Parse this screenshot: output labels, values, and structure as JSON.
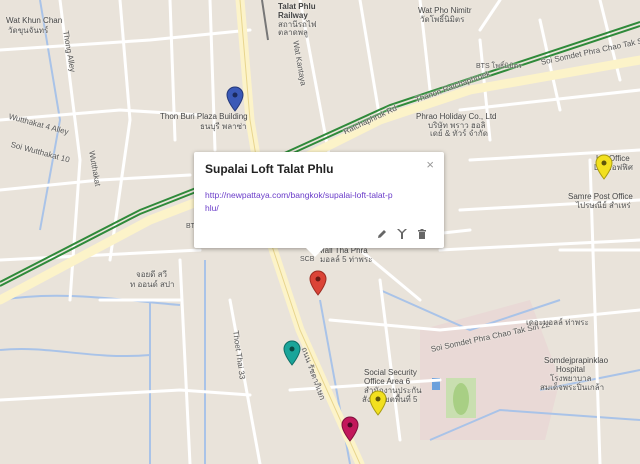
{
  "map": {
    "labels": [
      {
        "text": "Wat Khun Chan"
      },
      {
        "text": "วัดขุนจันทร์"
      },
      {
        "text": "Thong Alley"
      },
      {
        "text": "Talat Phlu"
      },
      {
        "text": "Railway"
      },
      {
        "text": "สถานีรถไฟ"
      },
      {
        "text": "ตลาดพลู"
      },
      {
        "text": "Wat Pho Nimitr"
      },
      {
        "text": "วัดโพธิ์นิมิตร"
      },
      {
        "text": "BTS โพธิ์นิมิตร"
      },
      {
        "text": "Wat Kantaya"
      },
      {
        "text": "Thon Buri Plaza Building"
      },
      {
        "text": "ธนบุรี พลาซ่า"
      },
      {
        "text": "Wutthakat 4 Alley"
      },
      {
        "text": "Soi Wutthakat 10"
      },
      {
        "text": "Wutthakat"
      },
      {
        "text": "Ratchaphruk Rd"
      },
      {
        "text": "Thanon Ratchaphruek"
      },
      {
        "text": "Soi Somdet Phra Chao Tak Sin"
      },
      {
        "text": "Phrao Holiday Co., Ltd"
      },
      {
        "text": "บริษัท พราว ฮอลิ"
      },
      {
        "text": "เดย์ & ทัวร์ จำกัด"
      },
      {
        "text": "LG Office"
      },
      {
        "text": "LG ออฟฟิศ"
      },
      {
        "text": "Samre Post Office"
      },
      {
        "text": "ไปรษณีย์ สำเหร่"
      },
      {
        "text": "Mall Tha Phra"
      },
      {
        "text": "มอลล์ 5 ท่าพระ"
      },
      {
        "text": "Soi Somdet Phra Chao Tak Sin 22"
      },
      {
        "text": "เดอะมอลล์ ท่าพระ"
      },
      {
        "text": "Somdejprapinklao"
      },
      {
        "text": "Hospital"
      },
      {
        "text": "โรงพยาบาล"
      },
      {
        "text": "สมเด็จพระปิ่นเกล้า"
      },
      {
        "text": "จอยดี สวี"
      },
      {
        "text": "ท ออนด์ สปา"
      },
      {
        "text": "Thoet Thai 33"
      },
      {
        "text": "ถนน รัชดาภิเษก"
      },
      {
        "text": "Social Security"
      },
      {
        "text": "Office Area 6"
      },
      {
        "text": "สำนักงานประกัน"
      },
      {
        "text": "สังคมเขตพื้นที่ 5"
      },
      {
        "text": "BTS"
      },
      {
        "text": "SCB"
      }
    ],
    "markers": [
      {
        "name": "blue-marker",
        "color": "#3a59b7"
      },
      {
        "name": "yellow-marker",
        "color": "#f2e01f"
      },
      {
        "name": "red-marker",
        "color": "#db4437"
      },
      {
        "name": "teal-marker",
        "color": "#1aa59a"
      },
      {
        "name": "yellow-marker-2",
        "color": "#f2e01f"
      },
      {
        "name": "magenta-marker",
        "color": "#c2185b"
      }
    ]
  },
  "popup": {
    "title": "Supalai Loft Talat Phlu",
    "close_icon": "×",
    "link": "http://newpattaya.com/bangkok/supalai-loft-talat-phlu/",
    "tools": [
      "pencil-icon",
      "style-icon",
      "trash-icon"
    ]
  },
  "colors": {
    "land": "#e9e3da",
    "road": "#ffffff",
    "major_road": "#fcf3c9",
    "rail_green": "#2f8a3a",
    "water": "#a9c3e8",
    "park": "#c9dfb0",
    "hospital": "#e9d9d6"
  }
}
